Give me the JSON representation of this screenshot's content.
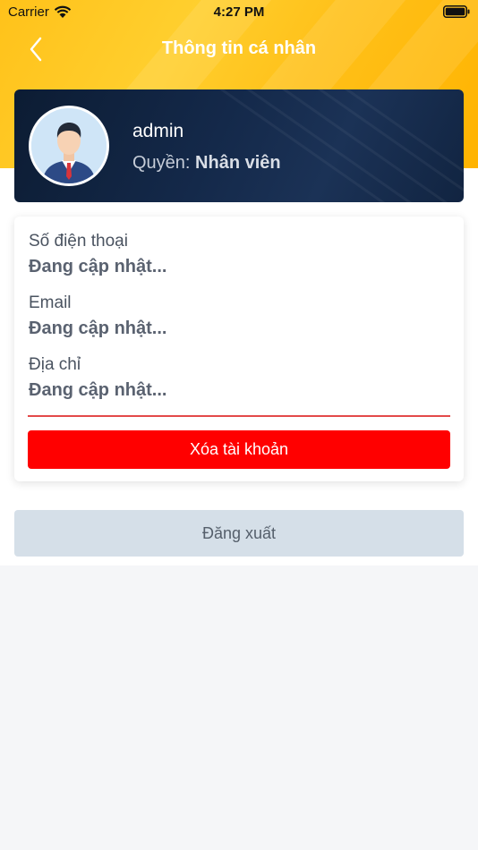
{
  "status_bar": {
    "carrier": "Carrier",
    "time": "4:27 PM"
  },
  "nav": {
    "title": "Thông tin cá nhân",
    "back_icon": "chevron-left-icon"
  },
  "profile": {
    "username": "admin",
    "role_label": "Quyền:",
    "role_value": "Nhân viên"
  },
  "info": {
    "fields": [
      {
        "label": "Số điện thoại",
        "value": "Đang cập nhật..."
      },
      {
        "label": "Email",
        "value": "Đang cập nhật..."
      },
      {
        "label": "Địa chỉ",
        "value": "Đang cập nhật..."
      }
    ],
    "delete_button": "Xóa tài khoản"
  },
  "logout_button": "Đăng xuất",
  "colors": {
    "header": "#ffc21a",
    "card": "#14294a",
    "danger": "#ff0000",
    "logout_bg": "#d5dfe8"
  }
}
